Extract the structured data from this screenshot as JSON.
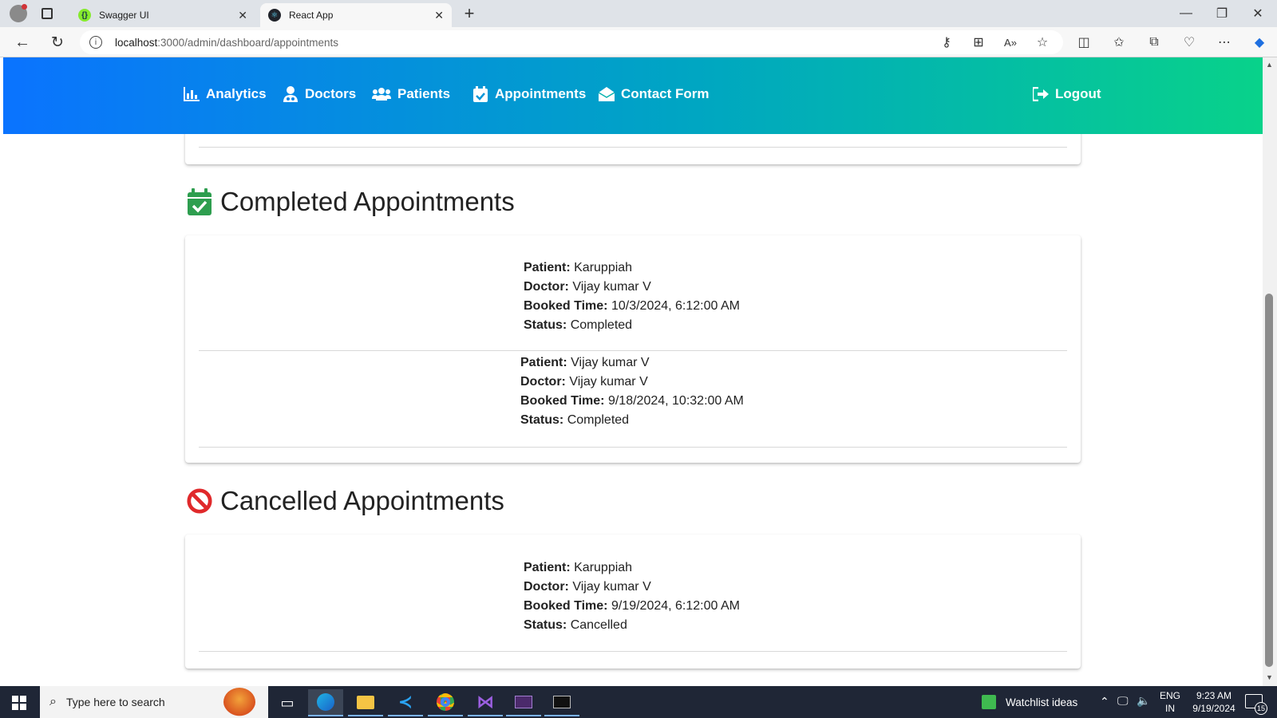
{
  "browser": {
    "tabs": [
      {
        "title": "Swagger UI",
        "active": false
      },
      {
        "title": "React App",
        "active": true
      }
    ],
    "url_host": "localhost",
    "url_path": ":3000/admin/dashboard/appointments"
  },
  "nav": {
    "items": [
      "Analytics",
      "Doctors",
      "Patients",
      "Appointments",
      "Contact Form"
    ],
    "logout": "Logout"
  },
  "labels": {
    "patient": "Patient:",
    "doctor": "Doctor:",
    "booked_time": "Booked Time:",
    "status": "Status:"
  },
  "completed": {
    "title": "Completed Appointments",
    "appointments": [
      {
        "patient": "Karuppiah",
        "doctor": "Vijay kumar V",
        "booked_time": "10/3/2024, 6:12:00 AM",
        "status": "Completed"
      },
      {
        "patient": "Vijay kumar V",
        "doctor": "Vijay kumar V",
        "booked_time": "9/18/2024, 10:32:00 AM",
        "status": "Completed"
      }
    ]
  },
  "cancelled": {
    "title": "Cancelled Appointments",
    "appointments": [
      {
        "patient": "Karuppiah",
        "doctor": "Vijay kumar V",
        "booked_time": "9/19/2024, 6:12:00 AM",
        "status": "Cancelled"
      }
    ]
  },
  "taskbar": {
    "search_placeholder": "Type here to search",
    "widget": "Watchlist ideas",
    "lang": "ENG",
    "region": "IN",
    "time": "9:23 AM",
    "date": "9/19/2024",
    "notifications": "15"
  },
  "colors": {
    "nav_gradient_start": "#0a73ff",
    "nav_gradient_end": "#08d28a",
    "completed_icon": "#2e9e4f",
    "cancelled_icon": "#e0292b"
  }
}
